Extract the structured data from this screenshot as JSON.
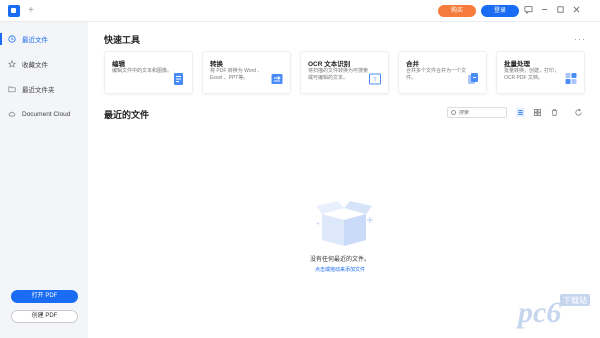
{
  "titlebar": {
    "new_tab": "+",
    "buy_label": "购买",
    "login_label": "登录",
    "icons": [
      "message-icon",
      "minimize-icon",
      "maximize-icon",
      "close-icon"
    ]
  },
  "sidebar": {
    "items": [
      {
        "label": "最近文件",
        "icon": "clock-icon",
        "active": true
      },
      {
        "label": "收藏文件",
        "icon": "star-icon",
        "active": false
      },
      {
        "label": "最近文件夹",
        "icon": "folder-icon",
        "active": false
      },
      {
        "label": "Document Cloud",
        "icon": "cloud-icon",
        "active": false
      }
    ],
    "open_pdf": "打开 PDF",
    "create_pdf": "创建 PDF"
  },
  "quick_tools": {
    "title": "快速工具",
    "more": "···",
    "cards": [
      {
        "title": "编辑",
        "desc": "编辑文件中的文本和图像。",
        "icon": "edit-doc-icon"
      },
      {
        "title": "转换",
        "desc": "将 PDF 转换为 Word 、Excel 、PPT等。",
        "icon": "convert-icon"
      },
      {
        "title": "OCR 文本识别",
        "desc": "将扫描的文件转换为可搜索或可编辑的文本。",
        "icon": "ocr-icon"
      },
      {
        "title": "合并",
        "desc": "合并多个文件合并为一个文件。",
        "icon": "merge-icon"
      },
      {
        "title": "批量处理",
        "desc": "批量转换，创建，打印，OCR PDF 文档。",
        "icon": "batch-icon"
      }
    ]
  },
  "recent": {
    "title": "最近的文件",
    "search_placeholder": "搜索",
    "empty_text": "没有任何最近的文件。",
    "empty_link": "点击或拖动来添加文件"
  },
  "watermark": {
    "text": "pc6",
    "sub": "下载站"
  },
  "colors": {
    "accent": "#1a6df2",
    "buy": "#f57c3c",
    "sidebar_bg": "#f4f5f8"
  }
}
